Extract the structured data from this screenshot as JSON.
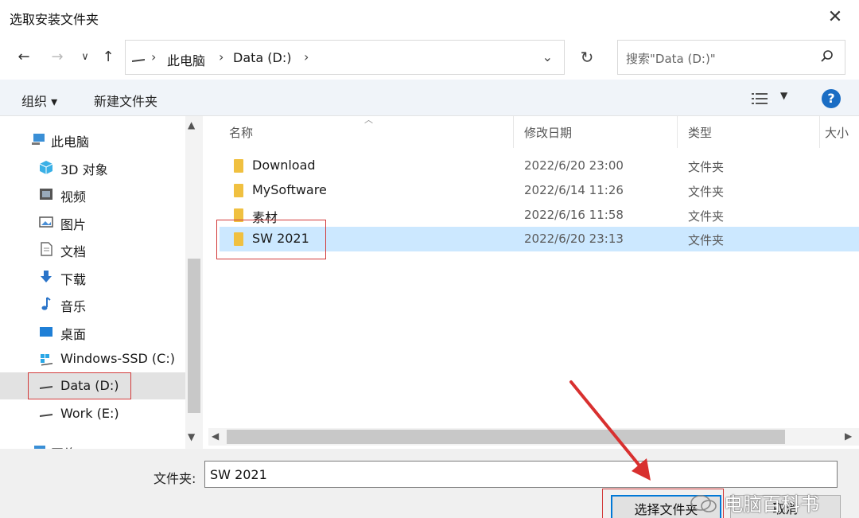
{
  "window": {
    "title": "选取安装文件夹"
  },
  "address": {
    "crumbs": [
      "此电脑",
      "Data (D:)"
    ]
  },
  "search": {
    "placeholder": "搜索\"Data (D:)\""
  },
  "toolbar": {
    "organize": "组织 ▾",
    "new_folder": "新建文件夹",
    "help": "?"
  },
  "sidebar": {
    "items": [
      {
        "label": "此电脑",
        "icon": "computer-icon"
      },
      {
        "label": "3D 对象",
        "icon": "cube-icon"
      },
      {
        "label": "视频",
        "icon": "video-icon"
      },
      {
        "label": "图片",
        "icon": "picture-icon"
      },
      {
        "label": "文档",
        "icon": "document-icon"
      },
      {
        "label": "下载",
        "icon": "download-icon"
      },
      {
        "label": "音乐",
        "icon": "music-icon"
      },
      {
        "label": "桌面",
        "icon": "desktop-icon"
      },
      {
        "label": "Windows-SSD (C:)",
        "icon": "windows-drive-icon"
      },
      {
        "label": "Data (D:)",
        "icon": "drive-icon"
      },
      {
        "label": "Work (E:)",
        "icon": "drive-icon"
      },
      {
        "label": "网络",
        "icon": "network-icon"
      }
    ]
  },
  "list": {
    "columns": [
      "名称",
      "修改日期",
      "类型",
      "大小"
    ],
    "rows": [
      {
        "name": "Download",
        "date": "2022/6/20 23:00",
        "type": "文件夹"
      },
      {
        "name": "MySoftware",
        "date": "2022/6/14 11:26",
        "type": "文件夹"
      },
      {
        "name": "素材",
        "date": "2022/6/16 11:58",
        "type": "文件夹"
      },
      {
        "name": "SW 2021",
        "date": "2022/6/20 23:13",
        "type": "文件夹"
      }
    ]
  },
  "footer": {
    "folder_label": "文件夹:",
    "folder_value": "SW 2021",
    "select_button": "选择文件夹",
    "cancel_button": "取消"
  },
  "watermark": {
    "text": "电脑百科书"
  },
  "colors": {
    "accent": "#0078d7",
    "selection": "#cce8ff",
    "highlight_box": "#d23a3a",
    "folder": "#f0c040"
  }
}
